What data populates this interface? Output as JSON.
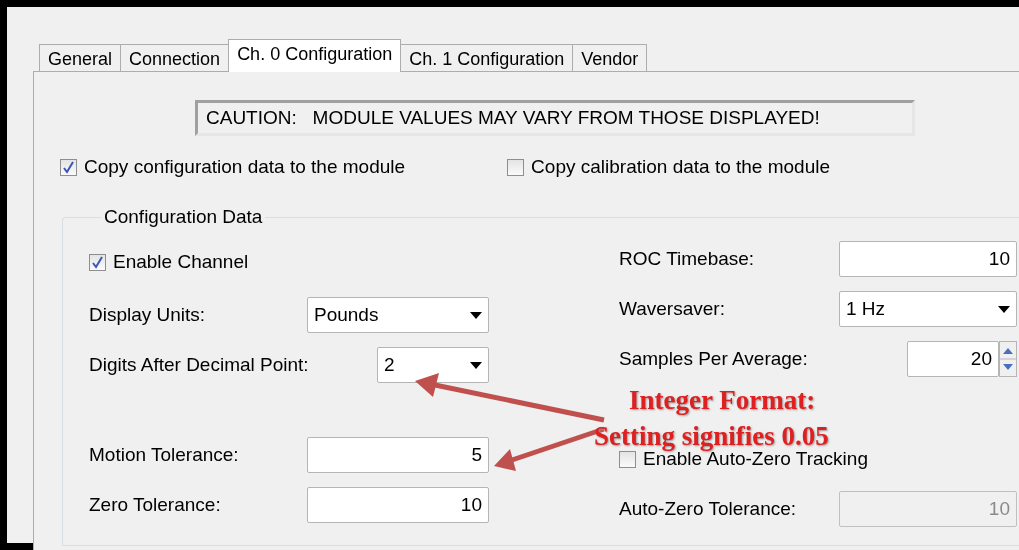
{
  "tabs": [
    {
      "label": "General",
      "selected": false
    },
    {
      "label": "Connection",
      "selected": false
    },
    {
      "label": "Ch. 0 Configuration",
      "selected": true
    },
    {
      "label": "Ch. 1 Configuration",
      "selected": false
    },
    {
      "label": "Vendor",
      "selected": false
    }
  ],
  "caution": "CAUTION:   MODULE VALUES MAY VARY FROM THOSE DISPLAYED!",
  "copy_options": [
    {
      "label": "Copy configuration data to the module",
      "checked": true
    },
    {
      "label": "Copy calibration data to the module",
      "checked": false
    }
  ],
  "group": {
    "title": "Configuration Data",
    "left": [
      {
        "kind": "checkbox",
        "label": "Enable Channel",
        "checked": true
      },
      {
        "kind": "dropdown",
        "label": "Display Units:",
        "value": "Pounds"
      },
      {
        "kind": "dropdown",
        "label": "Digits After Decimal Point:",
        "value": "2"
      },
      {
        "kind": "text",
        "label": "Motion Tolerance:",
        "value": "5",
        "disabled": false
      },
      {
        "kind": "text",
        "label": "Zero Tolerance:",
        "value": "10",
        "disabled": false
      }
    ],
    "right": [
      {
        "kind": "text",
        "label": "ROC Timebase:",
        "value": "10",
        "disabled": false
      },
      {
        "kind": "dropdown",
        "label": "Waversaver:",
        "value": "1 Hz"
      },
      {
        "kind": "spinner",
        "label": "Samples Per Average:",
        "value": "20"
      },
      {
        "kind": "checkbox",
        "label": "Enable Auto-Zero Tracking",
        "checked": false
      },
      {
        "kind": "text",
        "label": "Auto-Zero Tolerance:",
        "value": "10",
        "disabled": true
      }
    ]
  },
  "annotation": {
    "lines": [
      "Integer Format:",
      "Setting signifies 0.05"
    ]
  }
}
